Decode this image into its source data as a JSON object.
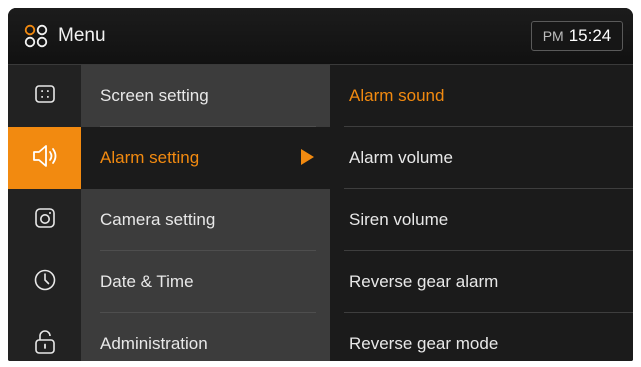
{
  "header": {
    "title": "Menu",
    "menu_icon": "grid-circles-icon",
    "clock": {
      "ampm": "PM",
      "time": "15:24"
    }
  },
  "colors": {
    "accent": "#f28a10",
    "header_bg": "#141414",
    "icon_column_bg": "#222222",
    "category_bg": "#3c3c3c",
    "submenu_bg": "#1b1b1b",
    "text": "#e8e8e8"
  },
  "categories": [
    {
      "label": "Screen setting",
      "icon": "screen-icon",
      "active": false
    },
    {
      "label": "Alarm setting",
      "icon": "speaker-icon",
      "active": true
    },
    {
      "label": "Camera setting",
      "icon": "camera-icon",
      "active": false
    },
    {
      "label": "Date & Time",
      "icon": "clock-icon",
      "active": false
    },
    {
      "label": "Administration",
      "icon": "lock-icon",
      "active": false
    }
  ],
  "submenu": [
    {
      "label": "Alarm sound",
      "active": true
    },
    {
      "label": "Alarm volume",
      "active": false
    },
    {
      "label": "Siren volume",
      "active": false
    },
    {
      "label": "Reverse gear alarm",
      "active": false
    },
    {
      "label": "Reverse gear mode",
      "active": false
    }
  ]
}
